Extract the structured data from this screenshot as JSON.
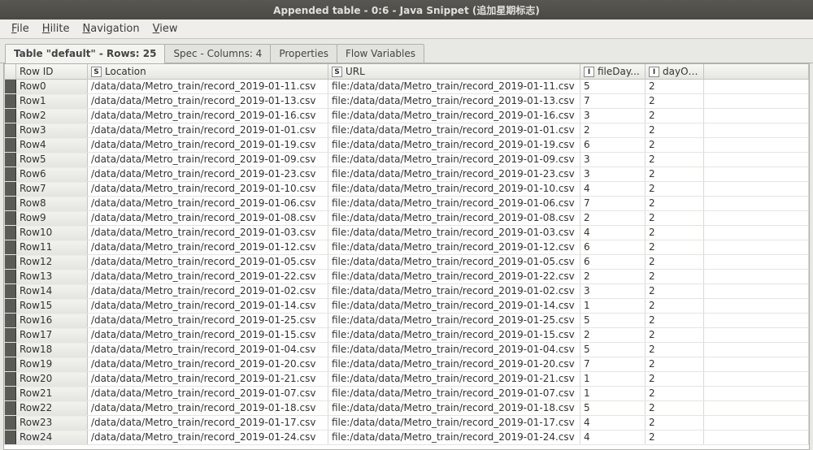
{
  "window_title": "Appended table - 0:6 - Java Snippet (追加星期标志)",
  "menu": {
    "file": "File",
    "hilite": "Hilite",
    "navigation": "Navigation",
    "view": "View"
  },
  "tabs": [
    {
      "label": "Table \"default\" - Rows: 25",
      "active": true
    },
    {
      "label": "Spec - Columns: 4",
      "active": false
    },
    {
      "label": "Properties",
      "active": false
    },
    {
      "label": "Flow Variables",
      "active": false
    }
  ],
  "columns": {
    "rowid": {
      "label": "Row ID"
    },
    "location": {
      "type": "S",
      "label": "Location"
    },
    "url": {
      "type": "S",
      "label": "URL"
    },
    "fileDay": {
      "type": "I",
      "label": "fileDay..."
    },
    "dayOf": {
      "type": "I",
      "label": "dayOf..."
    }
  },
  "rows": [
    {
      "id": "Row0",
      "location": "/data/data/Metro_train/record_2019-01-11.csv",
      "url": "file:/data/data/Metro_train/record_2019-01-11.csv",
      "fileDay": "5",
      "dayOf": "2"
    },
    {
      "id": "Row1",
      "location": "/data/data/Metro_train/record_2019-01-13.csv",
      "url": "file:/data/data/Metro_train/record_2019-01-13.csv",
      "fileDay": "7",
      "dayOf": "2"
    },
    {
      "id": "Row2",
      "location": "/data/data/Metro_train/record_2019-01-16.csv",
      "url": "file:/data/data/Metro_train/record_2019-01-16.csv",
      "fileDay": "3",
      "dayOf": "2"
    },
    {
      "id": "Row3",
      "location": "/data/data/Metro_train/record_2019-01-01.csv",
      "url": "file:/data/data/Metro_train/record_2019-01-01.csv",
      "fileDay": "2",
      "dayOf": "2"
    },
    {
      "id": "Row4",
      "location": "/data/data/Metro_train/record_2019-01-19.csv",
      "url": "file:/data/data/Metro_train/record_2019-01-19.csv",
      "fileDay": "6",
      "dayOf": "2"
    },
    {
      "id": "Row5",
      "location": "/data/data/Metro_train/record_2019-01-09.csv",
      "url": "file:/data/data/Metro_train/record_2019-01-09.csv",
      "fileDay": "3",
      "dayOf": "2"
    },
    {
      "id": "Row6",
      "location": "/data/data/Metro_train/record_2019-01-23.csv",
      "url": "file:/data/data/Metro_train/record_2019-01-23.csv",
      "fileDay": "3",
      "dayOf": "2"
    },
    {
      "id": "Row7",
      "location": "/data/data/Metro_train/record_2019-01-10.csv",
      "url": "file:/data/data/Metro_train/record_2019-01-10.csv",
      "fileDay": "4",
      "dayOf": "2"
    },
    {
      "id": "Row8",
      "location": "/data/data/Metro_train/record_2019-01-06.csv",
      "url": "file:/data/data/Metro_train/record_2019-01-06.csv",
      "fileDay": "7",
      "dayOf": "2"
    },
    {
      "id": "Row9",
      "location": "/data/data/Metro_train/record_2019-01-08.csv",
      "url": "file:/data/data/Metro_train/record_2019-01-08.csv",
      "fileDay": "2",
      "dayOf": "2"
    },
    {
      "id": "Row10",
      "location": "/data/data/Metro_train/record_2019-01-03.csv",
      "url": "file:/data/data/Metro_train/record_2019-01-03.csv",
      "fileDay": "4",
      "dayOf": "2"
    },
    {
      "id": "Row11",
      "location": "/data/data/Metro_train/record_2019-01-12.csv",
      "url": "file:/data/data/Metro_train/record_2019-01-12.csv",
      "fileDay": "6",
      "dayOf": "2"
    },
    {
      "id": "Row12",
      "location": "/data/data/Metro_train/record_2019-01-05.csv",
      "url": "file:/data/data/Metro_train/record_2019-01-05.csv",
      "fileDay": "6",
      "dayOf": "2"
    },
    {
      "id": "Row13",
      "location": "/data/data/Metro_train/record_2019-01-22.csv",
      "url": "file:/data/data/Metro_train/record_2019-01-22.csv",
      "fileDay": "2",
      "dayOf": "2"
    },
    {
      "id": "Row14",
      "location": "/data/data/Metro_train/record_2019-01-02.csv",
      "url": "file:/data/data/Metro_train/record_2019-01-02.csv",
      "fileDay": "3",
      "dayOf": "2"
    },
    {
      "id": "Row15",
      "location": "/data/data/Metro_train/record_2019-01-14.csv",
      "url": "file:/data/data/Metro_train/record_2019-01-14.csv",
      "fileDay": "1",
      "dayOf": "2"
    },
    {
      "id": "Row16",
      "location": "/data/data/Metro_train/record_2019-01-25.csv",
      "url": "file:/data/data/Metro_train/record_2019-01-25.csv",
      "fileDay": "5",
      "dayOf": "2"
    },
    {
      "id": "Row17",
      "location": "/data/data/Metro_train/record_2019-01-15.csv",
      "url": "file:/data/data/Metro_train/record_2019-01-15.csv",
      "fileDay": "2",
      "dayOf": "2"
    },
    {
      "id": "Row18",
      "location": "/data/data/Metro_train/record_2019-01-04.csv",
      "url": "file:/data/data/Metro_train/record_2019-01-04.csv",
      "fileDay": "5",
      "dayOf": "2"
    },
    {
      "id": "Row19",
      "location": "/data/data/Metro_train/record_2019-01-20.csv",
      "url": "file:/data/data/Metro_train/record_2019-01-20.csv",
      "fileDay": "7",
      "dayOf": "2"
    },
    {
      "id": "Row20",
      "location": "/data/data/Metro_train/record_2019-01-21.csv",
      "url": "file:/data/data/Metro_train/record_2019-01-21.csv",
      "fileDay": "1",
      "dayOf": "2"
    },
    {
      "id": "Row21",
      "location": "/data/data/Metro_train/record_2019-01-07.csv",
      "url": "file:/data/data/Metro_train/record_2019-01-07.csv",
      "fileDay": "1",
      "dayOf": "2"
    },
    {
      "id": "Row22",
      "location": "/data/data/Metro_train/record_2019-01-18.csv",
      "url": "file:/data/data/Metro_train/record_2019-01-18.csv",
      "fileDay": "5",
      "dayOf": "2"
    },
    {
      "id": "Row23",
      "location": "/data/data/Metro_train/record_2019-01-17.csv",
      "url": "file:/data/data/Metro_train/record_2019-01-17.csv",
      "fileDay": "4",
      "dayOf": "2"
    },
    {
      "id": "Row24",
      "location": "/data/data/Metro_train/record_2019-01-24.csv",
      "url": "file:/data/data/Metro_train/record_2019-01-24.csv",
      "fileDay": "4",
      "dayOf": "2"
    }
  ]
}
